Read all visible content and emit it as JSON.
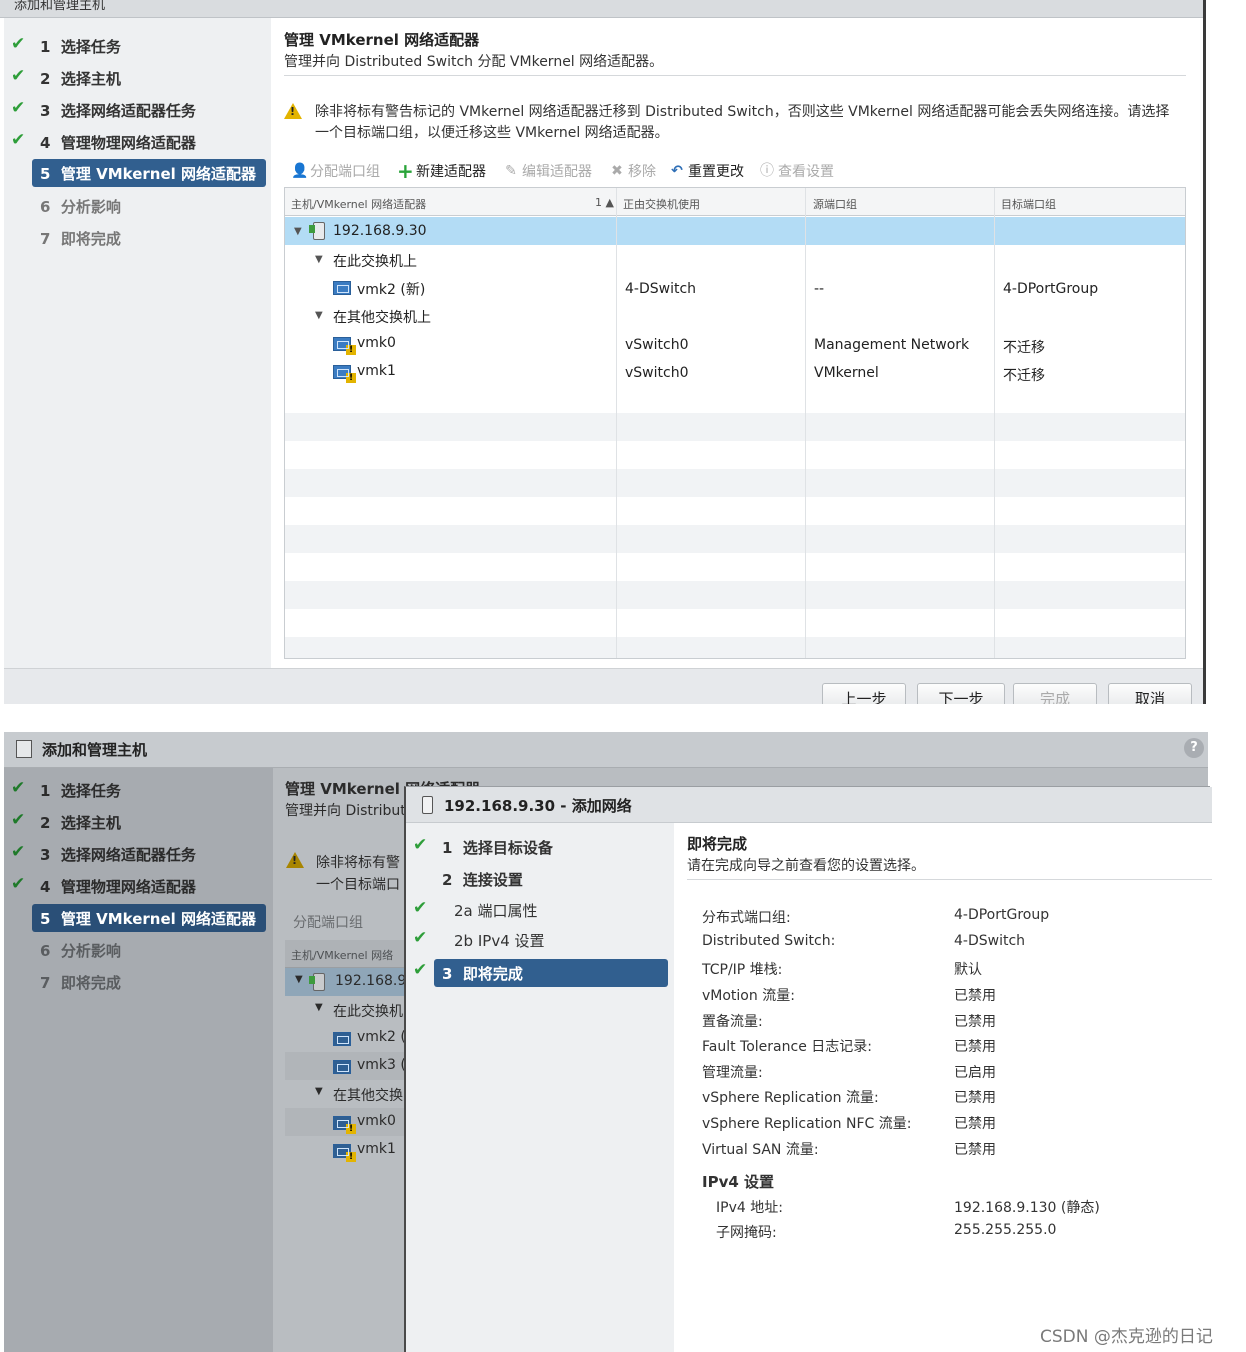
{
  "top": {
    "title": "添加和管理主机",
    "steps": [
      {
        "num": "1",
        "label": "选择任务",
        "state": "done"
      },
      {
        "num": "2",
        "label": "选择主机",
        "state": "done"
      },
      {
        "num": "3",
        "label": "选择网络适配器任务",
        "state": "done"
      },
      {
        "num": "4",
        "label": "管理物理网络适配器",
        "state": "done"
      },
      {
        "num": "5",
        "label": "管理 VMkernel 网络适配器",
        "state": "active"
      },
      {
        "num": "6",
        "label": "分析影响",
        "state": "pending"
      },
      {
        "num": "7",
        "label": "即将完成",
        "state": "pending"
      }
    ],
    "page_title": "管理 VMkernel 网络适配器",
    "page_subtitle": "管理并向 Distributed Switch 分配 VMkernel 网络适配器。",
    "warning_line1": "除非将标有警告标记的 VMkernel 网络适配器迁移到 Distributed Switch，否则这些 VMkernel 网络适配器可能会丢失网络连接。请选择",
    "warning_line2": "一个目标端口组，以便迁移这些 VMkernel 网络适配器。",
    "toolbar": {
      "assign": "分配端口组",
      "new_adapter": "新建适配器",
      "edit_adapter": "编辑适配器",
      "remove": "移除",
      "reset": "重置更改",
      "view_settings": "查看设置"
    },
    "columns": [
      "主机/VMkernel 网络适配器",
      "1 ▲",
      "正由交换机使用",
      "源端口组",
      "目标端口组"
    ],
    "rows": [
      {
        "name": "192.168.9.30",
        "switch": "",
        "source": "",
        "target": ""
      },
      {
        "name": "在此交换机上",
        "switch": "",
        "source": "",
        "target": ""
      },
      {
        "name": "vmk2 (新)",
        "switch": "4-DSwitch",
        "source": "--",
        "target": "4-DPortGroup"
      },
      {
        "name": "在其他交换机上",
        "switch": "",
        "source": "",
        "target": ""
      },
      {
        "name": "vmk0",
        "switch": "vSwitch0",
        "source": "Management Network",
        "target": "不迁移"
      },
      {
        "name": "vmk1",
        "switch": "vSwitch0",
        "source": "VMkernel",
        "target": "不迁移"
      }
    ],
    "buttons": {
      "back": "上一步",
      "next": "下一步",
      "finish": "完成",
      "cancel": "取消"
    }
  },
  "bottom": {
    "title": "添加和管理主机",
    "help": "?",
    "steps": [
      {
        "num": "1",
        "label": "选择任务"
      },
      {
        "num": "2",
        "label": "选择主机"
      },
      {
        "num": "3",
        "label": "选择网络适配器任务"
      },
      {
        "num": "4",
        "label": "管理物理网络适配器"
      },
      {
        "num": "5",
        "label": "管理 VMkernel 网络适配器"
      },
      {
        "num": "6",
        "label": "分析影响"
      },
      {
        "num": "7",
        "label": "即将完成"
      }
    ],
    "bg_title": "管理 VMkernel 网络适配器",
    "bg_subtitle": "管理并向 Distribut",
    "bg_warning1": "除非将标有警",
    "bg_warning2": "一个目标端口",
    "bg_toolbar": "分配端口组",
    "bg_col": "主机/VMkernel 网络",
    "bg_rows": [
      "192.168.9.",
      "在此交换机",
      "vmk2 (",
      "vmk3 (",
      "在其他交换",
      "vmk0",
      "vmk1"
    ],
    "dialog": {
      "title": "192.168.9.30 - 添加网络",
      "steps": [
        {
          "num": "1",
          "label": "选择目标设备"
        },
        {
          "num": "2",
          "label": "连接设置"
        },
        {
          "num": "2a",
          "label": "端口属性"
        },
        {
          "num": "2b",
          "label": "IPv4 设置"
        },
        {
          "num": "3",
          "label": "即将完成"
        }
      ],
      "heading": "即将完成",
      "subheading": "请在完成向导之前查看您的设置选择。",
      "settings": [
        {
          "label": "分布式端口组:",
          "value": "4-DPortGroup"
        },
        {
          "label": "Distributed Switch:",
          "value": "4-DSwitch"
        },
        {
          "label": "TCP/IP 堆栈:",
          "value": "默认"
        },
        {
          "label": "vMotion 流量:",
          "value": "已禁用"
        },
        {
          "label": "置备流量:",
          "value": "已禁用"
        },
        {
          "label": "Fault Tolerance 日志记录:",
          "value": "已禁用"
        },
        {
          "label": "管理流量:",
          "value": "已启用"
        },
        {
          "label": "vSphere Replication 流量:",
          "value": "已禁用"
        },
        {
          "label": "vSphere Replication NFC 流量:",
          "value": "已禁用"
        },
        {
          "label": "Virtual SAN 流量:",
          "value": "已禁用"
        }
      ],
      "ipv4_heading": "IPv4 设置",
      "ipv4": [
        {
          "label": "IPv4 地址:",
          "value": "192.168.9.130 (静态)"
        },
        {
          "label": "子网掩码:",
          "value": "255.255.255.0"
        }
      ]
    }
  },
  "watermark": "CSDN @杰克逊的日记"
}
